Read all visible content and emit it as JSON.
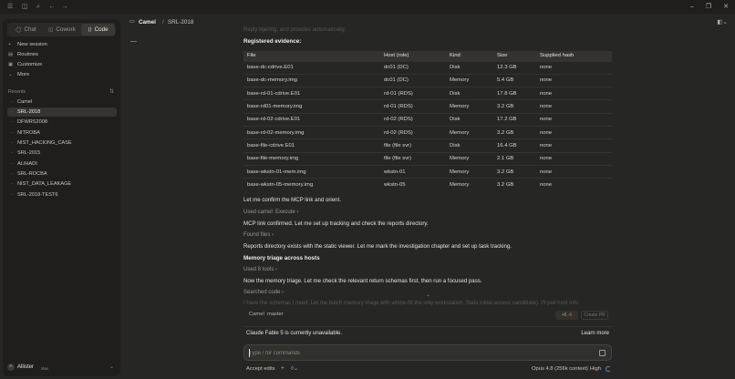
{
  "titlebar": {
    "menu_icon": "menu-icon",
    "sidebar_icon": "sidebar-toggle-icon",
    "search_icon": "search-icon",
    "back_icon": "arrow-left-icon",
    "forward_icon": "arrow-right-icon",
    "minimize": "–",
    "maximize": "❐",
    "close": "✕"
  },
  "sidebar": {
    "tabs": [
      {
        "label": "Chat",
        "icon": "chat-bubble-icon",
        "glyph": "◯",
        "active": false
      },
      {
        "label": "Cowork",
        "icon": "cowork-icon",
        "glyph": "◫",
        "active": false
      },
      {
        "label": "Code",
        "icon": "code-icon",
        "glyph": "⟨⟩",
        "active": true
      }
    ],
    "nav": [
      {
        "label": "New session",
        "icon": "plus-icon",
        "glyph": "+"
      },
      {
        "label": "Routines",
        "icon": "routines-icon",
        "glyph": "▤"
      },
      {
        "label": "Customize",
        "icon": "customize-icon",
        "glyph": "▣"
      },
      {
        "label": "More",
        "icon": "chevron-down-icon",
        "glyph": "⌄"
      }
    ],
    "recents_label": "Recents",
    "filter_glyph": "⇅",
    "recents": [
      {
        "label": "Camel",
        "active": false
      },
      {
        "label": "SRL-2018",
        "active": true
      },
      {
        "label": "DFWRS2008",
        "active": false
      },
      {
        "label": "NITROBA",
        "active": false
      },
      {
        "label": "NIST_HACKING_CASE",
        "active": false
      },
      {
        "label": "SRL-2015",
        "active": false
      },
      {
        "label": "ALIHADI",
        "active": false
      },
      {
        "label": "SRL-ROCBA",
        "active": false
      },
      {
        "label": "NIST_DATA_LEAKAGE",
        "active": false
      },
      {
        "label": "SRL-2018-TEST6",
        "active": false
      }
    ],
    "user": {
      "initial": "A",
      "name": "Allister",
      "plan": "Max",
      "chevron": "⌄"
    }
  },
  "header": {
    "project_glyph": "▭",
    "project": "Camel",
    "separator": "/",
    "session": "SRL-2018",
    "panel_glyph": "◧⌄",
    "collapse_glyph": "—"
  },
  "transcript": {
    "faded_top": "Reply ilgering, and provides automatically.",
    "registered_heading": "Registered evidence:",
    "table": {
      "headers": [
        "File",
        "Host (role)",
        "Kind",
        "Size",
        "Supplied hash"
      ],
      "rows": [
        [
          "base-dc-cdrive.E01",
          "dc01 (DC)",
          "Disk",
          "12.3 GB",
          "none"
        ],
        [
          "base-dc-memory.img",
          "dc01 (DC)",
          "Memory",
          "5.4 GB",
          "none"
        ],
        [
          "base-rd-01-cdrive.E01",
          "rd-01 (RDS)",
          "Disk",
          "17.8 GB",
          "none"
        ],
        [
          "base-rd01-memory.img",
          "rd-01 (RDS)",
          "Memory",
          "3.2 GB",
          "none"
        ],
        [
          "base-rd-02-cdrive.E01",
          "rd-02 (RDS)",
          "Disk",
          "17.2 GB",
          "none"
        ],
        [
          "base-rd-02-memory.img",
          "rd-02 (RDS)",
          "Memory",
          "3.2 GB",
          "none"
        ],
        [
          "base-file-cdrive.E01",
          "file (file svr)",
          "Disk",
          "16.4 GB",
          "none"
        ],
        [
          "base-file-memory.img",
          "file (file svr)",
          "Memory",
          "2.1 GB",
          "none"
        ],
        [
          "base-wkstn-01-mem.img",
          "wkstn-01",
          "Memory",
          "3.2 GB",
          "none"
        ],
        [
          "base-wkstn-05-memory.img",
          "wkstn-05",
          "Memory",
          "3.2 GB",
          "none"
        ]
      ]
    },
    "msg_confirm": "Let me confirm the MCP link and orient.",
    "tool_execute": "Used camel: Execute ›",
    "msg_link": "MCP link confirmed. Let me set up tracking and check the reports directory.",
    "tool_found": "Found files ›",
    "msg_reports": "Reports directory exists with the static viewer. Let me mark the investigation chapter and set up task tracking.",
    "memory_heading": "Memory triage across hosts",
    "tool_used": "Used 8 tools ›",
    "msg_triage": "Now the memory triage. Let me check the relevant return schemas first, then run a focused pass.",
    "tool_searched": "Searched code ›",
    "faded_bottom": "I have the schemas I need. Let me batch memory triage with whole-fill the only workstation. Stats initial access candidate). I'll pull host info",
    "scroll_chevron": "⌃"
  },
  "composer": {
    "repo": "Camel",
    "branch": "master",
    "diff_plus": "+6",
    "diff_minus": "-6",
    "create_pr": "Create PR",
    "notice": "Claude Fable 5 is currently unavailable.",
    "learn_more": "Learn more",
    "placeholder": "Type / for commands",
    "accept_edits": "Accept edits",
    "add_glyph": "+",
    "context_glyph": "◊⌄",
    "model": "Opus 4.8 (256k context)",
    "effort": "High"
  }
}
